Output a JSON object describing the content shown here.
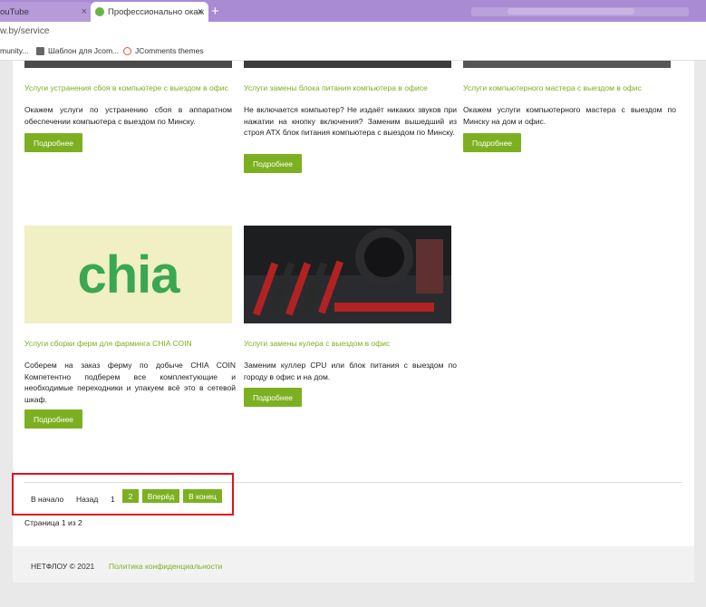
{
  "browser": {
    "tabs": [
      {
        "label": "ouTube"
      },
      {
        "label": "Профессионально окаж"
      }
    ],
    "new_tab": "+",
    "close_glyph": "×",
    "address": "w.by/service",
    "bookmarks": [
      {
        "label": "munity..."
      },
      {
        "label": "Шаблон для Jcom..."
      },
      {
        "label": "JComments themes"
      }
    ]
  },
  "services": [
    {
      "title": "Услуги устранения сбоя в компьютере с выездом в офис",
      "text": "Окажем услуги по устранению сбоя в аппаратном обеспечении компьютера с выездом по Минску.",
      "button": "Подробнее"
    },
    {
      "title": "Услуги замены блока питания компьютера в офисе",
      "text": "Не включается компьютер? Не издаёт никаких звуков при нажатии на кнопку включения? Заменим вышедший из строя ATX блок питания компьютера с выездом по Минску.",
      "button": "Подробнее"
    },
    {
      "title": "Услуги компьютерного мастера с выездом в офис",
      "text": "Окажем услуги компьютерного мастера с выездом по Минску на дом и офис.",
      "button": "Подробнее"
    },
    {
      "title": "Услуги сборки ферм для фарминга CHIA COIN",
      "text": "Соберем на заказ ферму по добыче CHIA COIN Компетентно подберем все комплектующие и необходимые переходники и упакуем всё это в сетевой шкаф.",
      "button": "Подробнее",
      "image_text": "chia"
    },
    {
      "title": "Услуги замены кулера с выездом в офис",
      "text": "Заменим куллер CPU или блок питания с выездом по городу в офис и на дом.",
      "button": "Подробнее"
    }
  ],
  "pagination": {
    "start": "В начало",
    "prev": "Назад",
    "page1": "1",
    "page2": "2",
    "next": "Вперёд",
    "end": "В конец",
    "info": "Страница 1 из 2"
  },
  "footer": {
    "copyright": "НЕТФЛОУ © 2021",
    "privacy": "Политика конфиденциальности"
  },
  "colors": {
    "accent": "#7cb021",
    "highlight": "#e0141a",
    "tabbar": "#a98bd3"
  }
}
